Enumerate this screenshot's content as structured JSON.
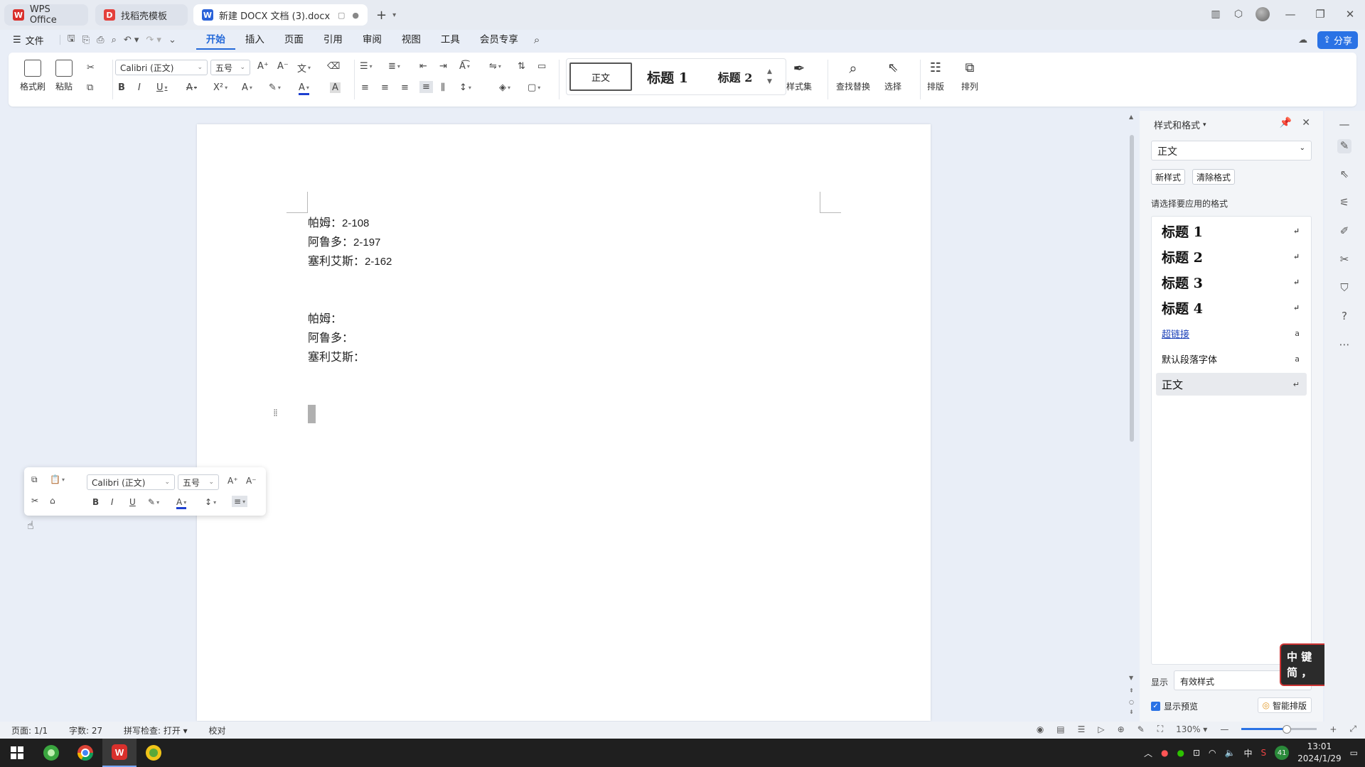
{
  "tabs": [
    {
      "label": "WPS Office",
      "icon": "wps-logo-icon"
    },
    {
      "label": "找稻壳模板",
      "icon": "docer-icon"
    },
    {
      "label": "新建 DOCX 文档 (3).docx",
      "icon": "word-doc-icon"
    }
  ],
  "menu": {
    "file": "文件",
    "ribbon_tabs": [
      "开始",
      "插入",
      "页面",
      "引用",
      "审阅",
      "视图",
      "工具",
      "会员专享"
    ],
    "active_tab": "开始",
    "share": "分享"
  },
  "ribbon": {
    "format_painter": "格式刷",
    "paste": "粘贴",
    "font_name": "Calibri (正文)",
    "font_size": "五号",
    "styles": [
      "正文",
      "标题  1",
      "标题  2"
    ],
    "style_set": "样式集",
    "find_replace": "查找替换",
    "select": "选择",
    "layout": "排版",
    "arrange": "排列"
  },
  "document": {
    "lines": [
      {
        "name": "帕姆：",
        "value": "2-108"
      },
      {
        "name": "阿鲁多：",
        "value": "2-197"
      },
      {
        "name": "塞利艾斯：",
        "value": "2-162"
      },
      {
        "name": "",
        "value": ""
      },
      {
        "name": "",
        "value": ""
      },
      {
        "name": "帕姆：",
        "value": ""
      },
      {
        "name": "阿鲁多：",
        "value": ""
      },
      {
        "name": "塞利艾斯：",
        "value": ""
      }
    ]
  },
  "minibar": {
    "font_name": "Calibri (正文)",
    "font_size": "五号"
  },
  "pane": {
    "title": "样式和格式",
    "current_style": "正文",
    "new_style": "新样式",
    "clear_format": "清除格式",
    "apply_label": "请选择要应用的格式",
    "styles": [
      {
        "name": "标题  1",
        "kind": "heading",
        "mark": "↵"
      },
      {
        "name": "标题  2",
        "kind": "heading",
        "mark": "↵"
      },
      {
        "name": "标题  3",
        "kind": "heading",
        "mark": "↵"
      },
      {
        "name": "标题  4",
        "kind": "heading",
        "mark": "↵"
      },
      {
        "name": "超链接",
        "kind": "link",
        "mark": "a"
      },
      {
        "name": "默认段落字体",
        "kind": "plain",
        "mark": "a"
      },
      {
        "name": "正文",
        "kind": "plain-selected",
        "mark": "↵"
      }
    ],
    "show_label": "显示",
    "show_value": "有效样式",
    "preview_label": "显示预览",
    "smart_layout": "智能排版"
  },
  "ime": {
    "line1": "中 键",
    "line2": "简 ，"
  },
  "status": {
    "page": "页面: 1/1",
    "words": "字数: 27",
    "spell": "拼写检查: 打开",
    "proof": "校对",
    "zoom": "130%",
    "zoom_fraction": 0.57
  },
  "clock": {
    "time": "13:01",
    "date": "2024/1/29"
  },
  "tray_badge": "41",
  "colors": {
    "accent": "#2368d8",
    "share": "#2a72e5",
    "wps_red": "#d9302c"
  }
}
